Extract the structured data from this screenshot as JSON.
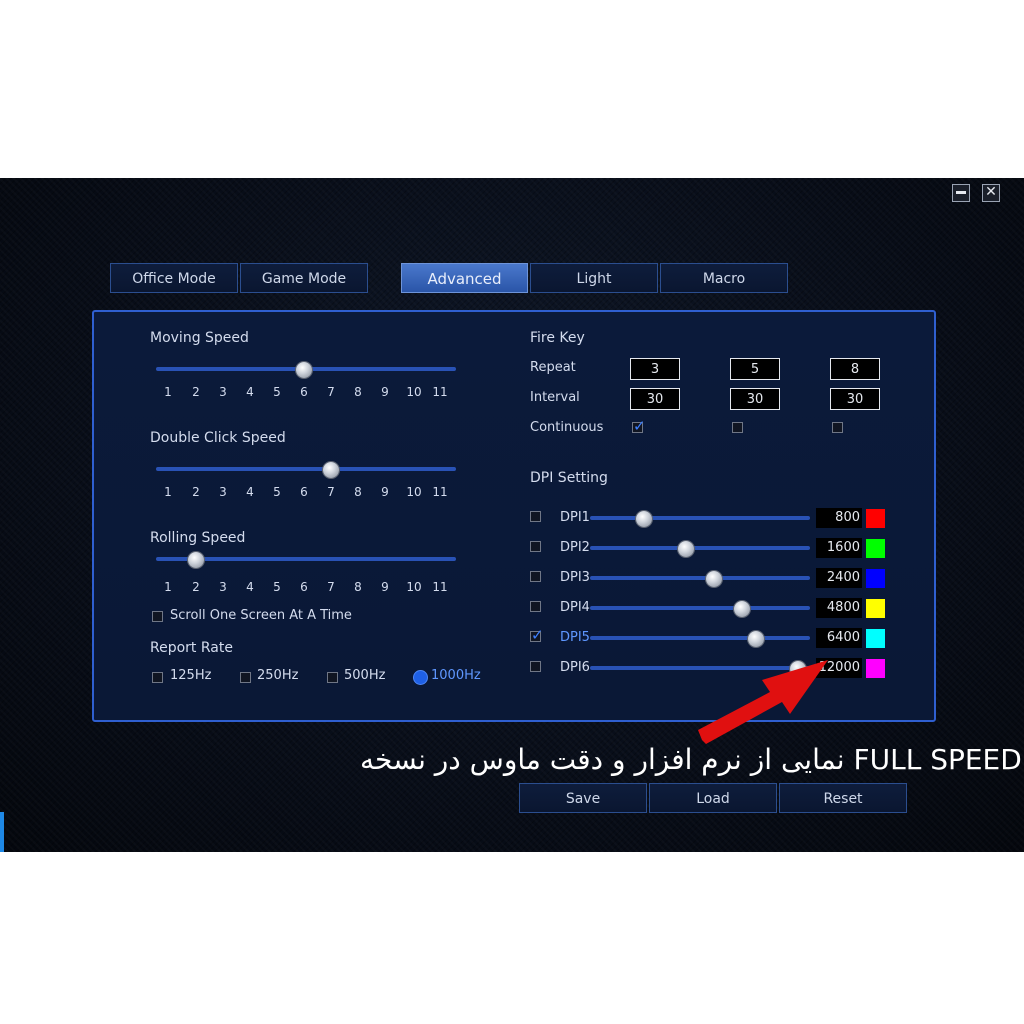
{
  "window": {
    "minimize_icon": "minimize-icon",
    "close_icon": "close-icon",
    "close_glyph": "✕"
  },
  "tabs": [
    {
      "label": "Office Mode",
      "active": false
    },
    {
      "label": "Game Mode",
      "active": false
    },
    {
      "label": "Advanced",
      "active": true
    },
    {
      "label": "Light",
      "active": false
    },
    {
      "label": "Macro",
      "active": false
    }
  ],
  "moving_speed": {
    "label": "Moving Speed",
    "value": 6
  },
  "double_click_speed": {
    "label": "Double Click Speed",
    "value": 7
  },
  "rolling_speed": {
    "label": "Rolling Speed",
    "value": 2
  },
  "ticks": [
    "1",
    "2",
    "3",
    "4",
    "5",
    "6",
    "7",
    "8",
    "9",
    "10",
    "11"
  ],
  "scroll_one_screen": {
    "label": "Scroll One Screen At A Time",
    "checked": false
  },
  "report_rate": {
    "label": "Report Rate",
    "options": [
      "125Hz",
      "250Hz",
      "500Hz",
      "1000Hz"
    ],
    "selected": "1000Hz"
  },
  "fire_key": {
    "label": "Fire Key",
    "repeat_label": "Repeat",
    "interval_label": "Interval",
    "continuous_label": "Continuous",
    "repeat": [
      "3",
      "5",
      "8"
    ],
    "interval": [
      "30",
      "30",
      "30"
    ],
    "continuous": [
      true,
      false,
      false
    ]
  },
  "dpi_setting": {
    "label": "DPI Setting",
    "levels": [
      {
        "label": "DPI1",
        "value": "800",
        "color": "#ff0000",
        "checked": false
      },
      {
        "label": "DPI2",
        "value": "1600",
        "color": "#00ff00",
        "checked": false
      },
      {
        "label": "DPI3",
        "value": "2400",
        "color": "#0000ff",
        "checked": false
      },
      {
        "label": "DPI4",
        "value": "4800",
        "color": "#ffff00",
        "checked": false
      },
      {
        "label": "DPI5",
        "value": "6400",
        "color": "#00ffff",
        "checked": true
      },
      {
        "label": "DPI6",
        "value": "12000",
        "color": "#ff00ff",
        "checked": false
      }
    ]
  },
  "buttons": {
    "save": "Save",
    "load": "Load",
    "reset": "Reset"
  },
  "caption": "نمایی از نرم افزار و دقت ماوس در نسخه FULL SPEED"
}
